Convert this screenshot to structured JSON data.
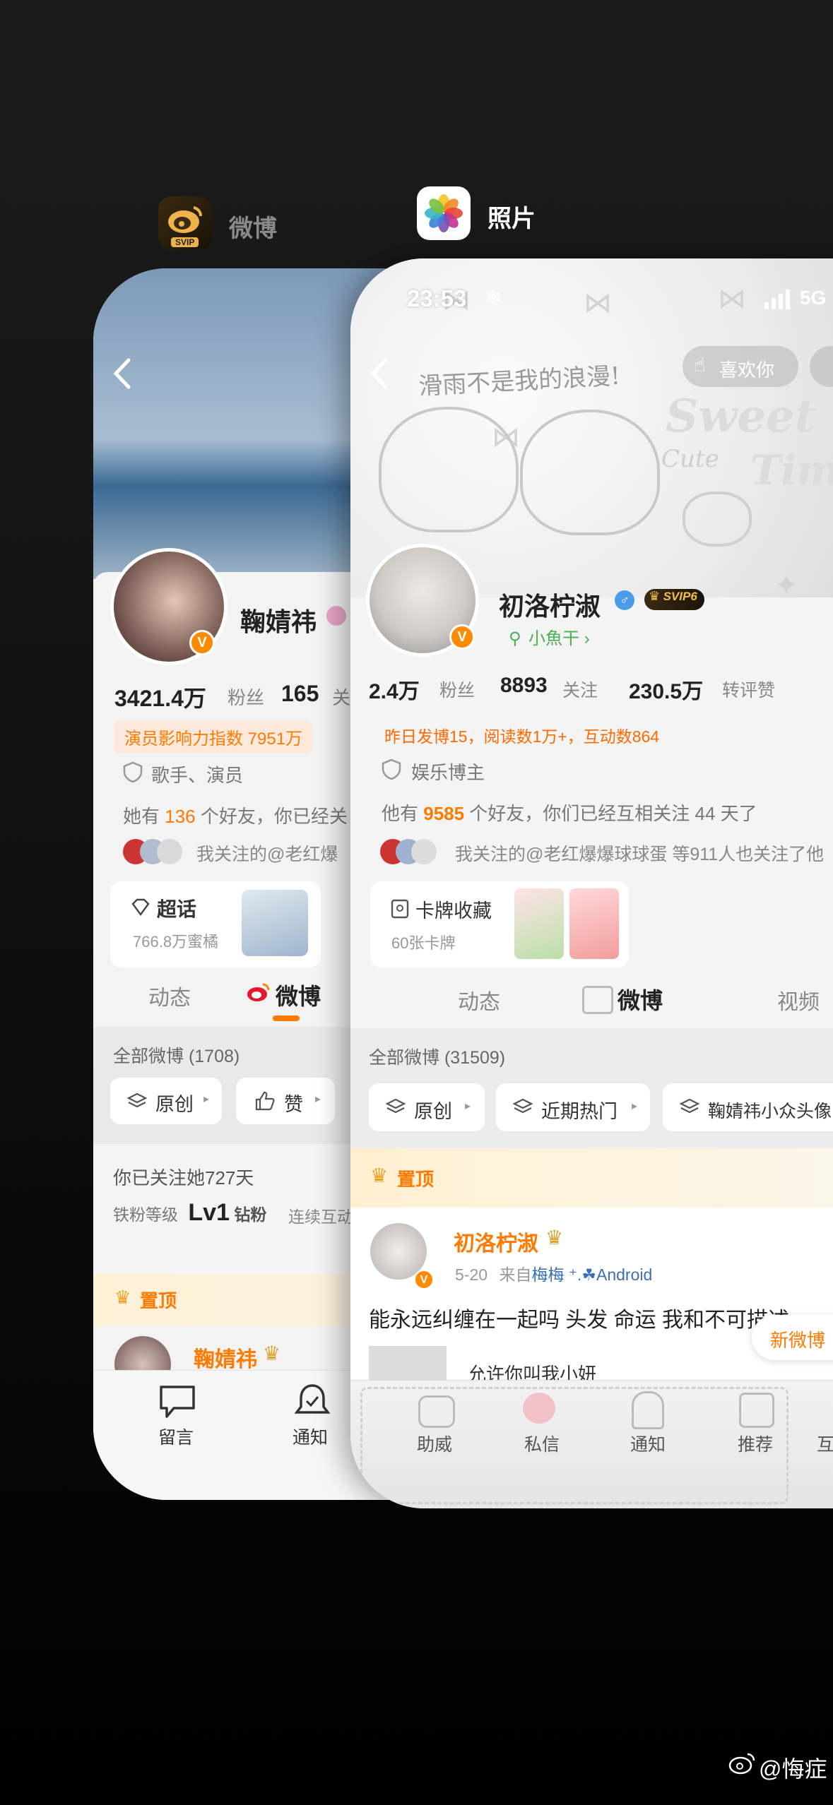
{
  "switcher": {
    "app1_label": "微博",
    "app2_label": "照片",
    "svip_badge": "SVIP"
  },
  "cardA": {
    "name": "鞠婧祎",
    "followers": "3421.4万",
    "followers_label": "粉丝",
    "following": "165",
    "following_label": "关",
    "influence": "演员影响力指数 7951万",
    "tag": "歌手、演员",
    "friends_prefix": "她有 ",
    "friends_count": "136",
    "friends_suffix": " 个好友，你已经关",
    "mutual": "我关注的@老红爆",
    "supertopic_title": "超话",
    "supertopic_sub": "766.8万蜜橘",
    "tab_dynamic": "动态",
    "tab_weibo": "微博",
    "all_weibo": "全部微博 (1708)",
    "filter_original": "原创",
    "filter_like": "赞",
    "follow_days": "你已关注她727天",
    "fan_level_label": "铁粉等级",
    "fan_level": "Lv1",
    "fan_level_suffix": "钻粉",
    "interact": "连续互动",
    "pinned": "置顶",
    "post_author": "鞠婧祎",
    "nav_message": "留言",
    "nav_notify": "通知"
  },
  "cardB": {
    "time": "23:53",
    "signal": "5G",
    "like_btn": "喜欢你",
    "header_doodle": "滑雨不是我的浪漫!",
    "header_sweet": "Sweet",
    "header_cute": "Cute",
    "header_time": "Timin",
    "name": "初洛柠淑",
    "svip": "SVIP6",
    "sub_badge": "小魚干 ›",
    "followers": "2.4万",
    "followers_label": "粉丝",
    "following": "8893",
    "following_label": "关注",
    "reposts": "230.5万",
    "reposts_label": "转评赞",
    "stats_line": "昨日发博15，阅读数1万+，互动数864",
    "tag": "娱乐博主",
    "friends_prefix": "他有 ",
    "friends_count": "9585",
    "friends_suffix": " 个好友，你们已经互相关注 44 天了",
    "mutual": "我关注的@老红爆爆球球蛋 等911人也关注了他",
    "card_title": "卡牌收藏",
    "card_sub": "60张卡牌",
    "tab_dynamic": "动态",
    "tab_weibo": "微博",
    "tab_video": "视频",
    "all_weibo": "全部微博 (31509)",
    "filter_original": "原创",
    "filter_hot": "近期热门",
    "filter_topic": "鞠婧祎小众头像",
    "pinned": "置顶",
    "post_author": "初洛柠淑",
    "post_meta_date": "5-20",
    "post_meta_from": "来自",
    "post_meta_device": "梅梅",
    "post_meta_android": "Android",
    "post_text": "能永远纠缠在一起吗 头发 命运 我和不可描述",
    "post_text2": "允许你叫我小妍",
    "new_weibo": "新微博",
    "nav_1": "助威",
    "nav_2": "私信",
    "nav_3": "通知",
    "nav_4": "推荐",
    "nav_5": "互"
  },
  "watermark": "@悔症",
  "colors": {
    "accent": "#ff7a00",
    "link_blue": "#3b6fb6"
  }
}
